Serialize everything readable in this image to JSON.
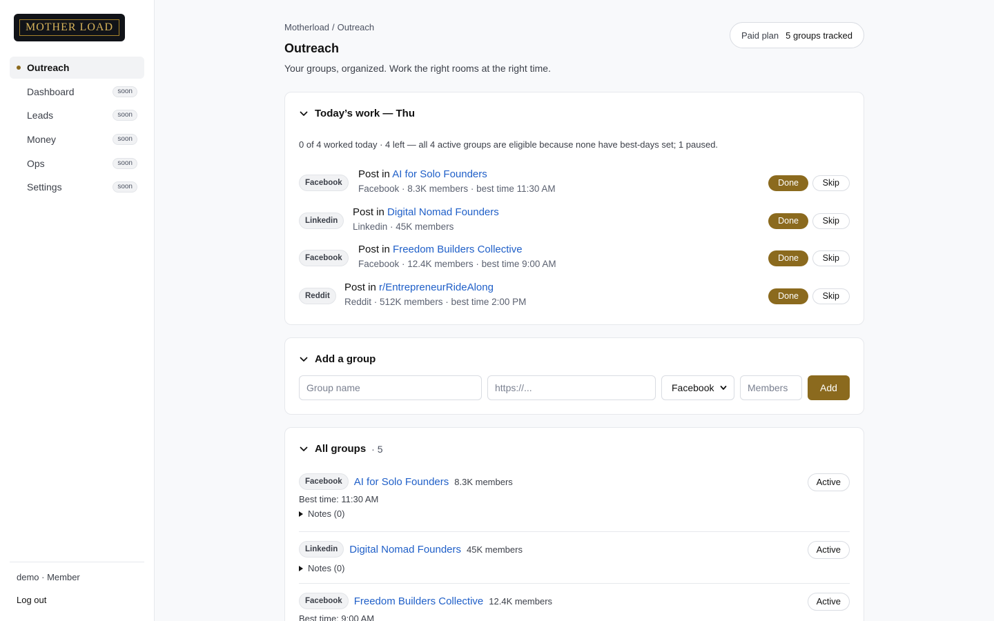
{
  "brand": {
    "logo_text": "MOTHER LOAD"
  },
  "sidebar": {
    "items": [
      {
        "label": "Outreach",
        "active": true
      },
      {
        "label": "Dashboard",
        "badge": "soon"
      },
      {
        "label": "Leads",
        "badge": "soon"
      },
      {
        "label": "Money",
        "badge": "soon"
      },
      {
        "label": "Ops",
        "badge": "soon"
      },
      {
        "label": "Settings",
        "badge": "soon"
      }
    ],
    "user": "demo · Member",
    "logout": "Log out"
  },
  "header": {
    "breadcrumb": [
      "Motherload",
      "/",
      "Outreach"
    ],
    "title": "Outreach",
    "subtitle": "Your groups, organized. Work the right rooms at the right time.",
    "plan": "Paid plan",
    "groups_tracked": "5 groups tracked"
  },
  "today": {
    "heading": "Today’s work — Thu",
    "summary": "0 of 4 worked today · 4 left — all 4 active groups are eligible because none have best-days set; 1 paused.",
    "post_prefix": "Post in",
    "done_label": "Done",
    "skip_label": "Skip",
    "tasks": [
      {
        "platform": "Facebook",
        "group": "AI for Solo Founders",
        "meta": "Facebook · 8.3K members · best time 11:30 AM"
      },
      {
        "platform": "Linkedin",
        "group": "Digital Nomad Founders",
        "meta": "Linkedin · 45K members"
      },
      {
        "platform": "Facebook",
        "group": "Freedom Builders Collective",
        "meta": "Facebook · 12.4K members · best time 9:00 AM"
      },
      {
        "platform": "Reddit",
        "group": "r/EntrepreneurRideAlong",
        "meta": "Reddit · 512K members · best time 2:00 PM"
      }
    ]
  },
  "add_group": {
    "heading": "Add a group",
    "name_placeholder": "Group name",
    "url_placeholder": "https://...",
    "platform_selected": "Facebook",
    "members_placeholder": "Members",
    "add_label": "Add"
  },
  "all_groups": {
    "heading": "All groups",
    "count": "· 5",
    "groups": [
      {
        "platform": "Facebook",
        "name": "AI for Solo Founders",
        "members": "8.3K members",
        "status": "Active",
        "best_time": "Best time: 11:30 AM",
        "notes": "Notes (0)"
      },
      {
        "platform": "Linkedin",
        "name": "Digital Nomad Founders",
        "members": "45K members",
        "status": "Active",
        "notes": "Notes (0)"
      },
      {
        "platform": "Facebook",
        "name": "Freedom Builders Collective",
        "members": "12.4K members",
        "status": "Active",
        "best_time": "Best time: 9:00 AM"
      }
    ]
  }
}
